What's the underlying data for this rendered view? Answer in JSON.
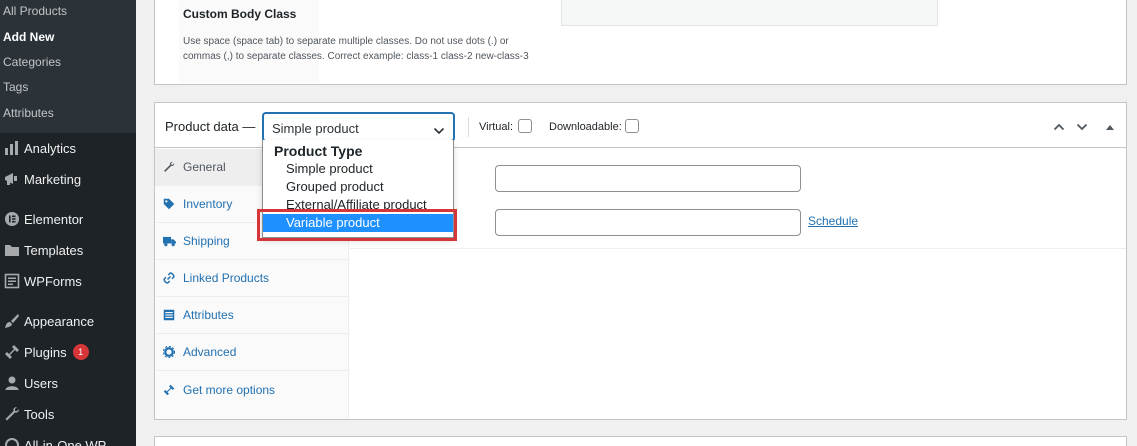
{
  "sidebar": {
    "submenu": [
      {
        "label": "All Products",
        "current": false
      },
      {
        "label": "Add New",
        "current": true
      },
      {
        "label": "Categories",
        "current": false
      },
      {
        "label": "Tags",
        "current": false
      },
      {
        "label": "Attributes",
        "current": false
      }
    ],
    "menu": [
      {
        "label": "Analytics",
        "icon": "bar-chart-icon"
      },
      {
        "label": "Marketing",
        "icon": "megaphone-icon"
      },
      {
        "label": "Elementor",
        "icon": "elementor-icon"
      },
      {
        "label": "Templates",
        "icon": "folder-icon"
      },
      {
        "label": "WPForms",
        "icon": "form-icon"
      },
      {
        "label": "Appearance",
        "icon": "paintbrush-icon"
      },
      {
        "label": "Plugins",
        "icon": "plugin-icon",
        "badge": "1"
      },
      {
        "label": "Users",
        "icon": "user-icon"
      },
      {
        "label": "Tools",
        "icon": "wrench-icon"
      },
      {
        "label": "All-in-One WP",
        "icon": "migration-icon"
      }
    ]
  },
  "custom_body_class": {
    "title": "Custom Body Class",
    "description": "Use space (space tab) to separate multiple classes. Do not use dots (.) or commas (,) to separate classes. Correct example: class-1 class-2 new-class-3"
  },
  "product_data": {
    "title": "Product data —",
    "selected_type": "Simple product",
    "virtual_label": "Virtual:",
    "downloadable_label": "Downloadable:",
    "tabs": [
      {
        "label": "General",
        "icon": "wrench-icon",
        "active": true
      },
      {
        "label": "Inventory",
        "icon": "tag-icon",
        "active": false
      },
      {
        "label": "Shipping",
        "icon": "truck-icon",
        "active": false
      },
      {
        "label": "Linked Products",
        "icon": "link-icon",
        "active": false
      },
      {
        "label": "Attributes",
        "icon": "list-icon",
        "active": false
      },
      {
        "label": "Advanced",
        "icon": "gear-icon",
        "active": false
      },
      {
        "label": "Get more options",
        "icon": "plug-icon",
        "active": false
      }
    ],
    "schedule_link": "Schedule",
    "dropdown": {
      "group_label": "Product Type",
      "options": [
        {
          "label": "Simple product",
          "highlighted": false
        },
        {
          "label": "Grouped product",
          "highlighted": false
        },
        {
          "label": "External/Affiliate product",
          "highlighted": false
        },
        {
          "label": "Variable product",
          "highlighted": true
        }
      ]
    }
  },
  "colors": {
    "sidebar_bg": "#1d2327",
    "submenu_bg": "#2c3338",
    "link_blue": "#2271b1",
    "highlight_blue": "#1e90ff",
    "annotation_red": "#d63638"
  }
}
